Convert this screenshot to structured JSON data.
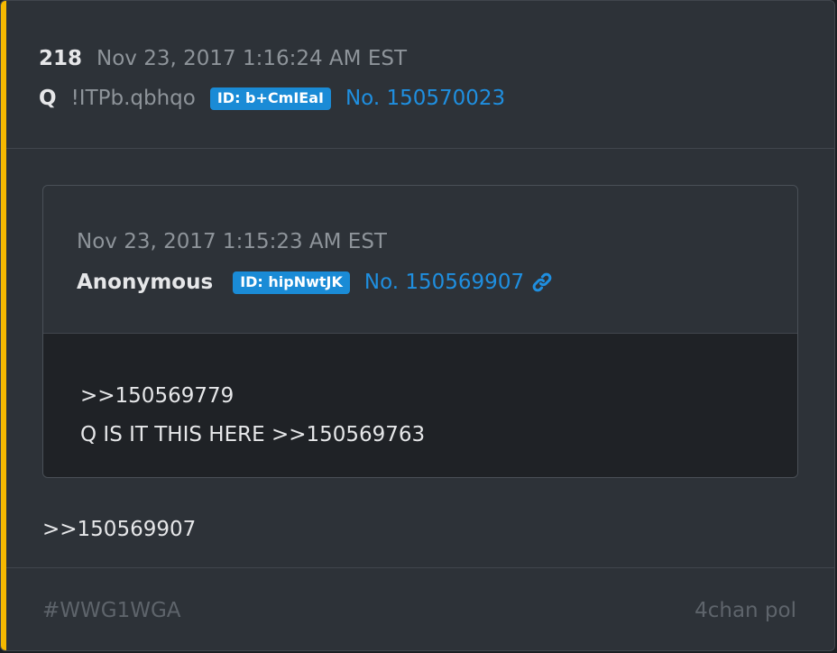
{
  "colors": {
    "accent_bar": "#f5b800",
    "card_background": "#2d3238",
    "quoted_body_background": "#1f2226",
    "badge_background": "#1a8bd6",
    "link_blue": "#1f8fe0",
    "muted_text": "#8e949a",
    "footer_text": "#5e646b"
  },
  "post": {
    "count": "218",
    "timestamp": "Nov 23, 2017 1:16:24 AM EST",
    "author": "Q",
    "tripcode": "!ITPb.qbhqo",
    "id_badge": "ID: b+CmIEaI",
    "number": "No. 150570023",
    "body": ">>150569907"
  },
  "quoted_post": {
    "timestamp": "Nov 23, 2017 1:15:23 AM EST",
    "author": "Anonymous",
    "id_badge": "ID: hipNwtJK",
    "number": "No. 150569907",
    "link_icon": "link-icon",
    "body_lines": [
      ">>150569779",
      "Q IS IT THIS HERE >>150569763"
    ]
  },
  "footer": {
    "tag": "#WWG1WGA",
    "source": "4chan pol"
  }
}
